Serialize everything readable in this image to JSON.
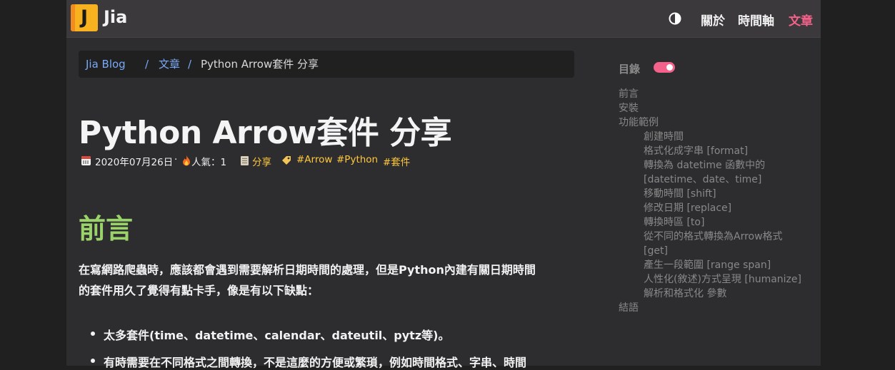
{
  "nav": {
    "logo_letter": "J",
    "site_name": "Jia",
    "theme_icon": "contrast-icon",
    "links": [
      "關於",
      "時間軸",
      "文章"
    ],
    "active_color": "#f4618a"
  },
  "breadcrumb": {
    "home": "Jia Blog",
    "sep": "/",
    "section": "文章",
    "current": "Python Arrow套件 分享"
  },
  "post": {
    "title": "Python Arrow套件 分享",
    "date": "2020年07月26日",
    "dot": "·",
    "popularity_label": "人氣：1",
    "category": "分享",
    "tags": [
      "#Arrow",
      "#Python",
      "#套件"
    ],
    "icons": [
      "calendar-icon",
      "fire-icon",
      "clipboard-icon",
      "tag-icon"
    ]
  },
  "content": {
    "heading": "前言",
    "heading_color": "#9bd36b",
    "paragraph_lines": [
      "在寫網路爬蟲時，應該都會遇到需要解析日期時間的處理，但是Python內建有關日期時間",
      "的套件用久了覺得有點卡手，像是有以下缺點："
    ],
    "bullets": [
      "太多套件(time、datetime、calendar、dateutil、pytz等)。",
      "有時需要在不同格式之間轉換，不是這麼的方便或繁瑣，例如時間格式、字串、時間"
    ]
  },
  "toc": {
    "label": "目錄",
    "toggle_on": true,
    "items": [
      {
        "text": "前言",
        "level": 1
      },
      {
        "text": "安裝",
        "level": 1
      },
      {
        "text": "功能範例",
        "level": 1
      },
      {
        "text": "創建時間",
        "level": 2
      },
      {
        "text": "格式化成字串 [format]",
        "level": 2
      },
      {
        "text": "轉換為 datetime 函數中的",
        "level": 2
      },
      {
        "text": "[datetime、date、time]",
        "level": 2
      },
      {
        "text": "移動時間 [shift]",
        "level": 2
      },
      {
        "text": "修改日期 [replace]",
        "level": 2
      },
      {
        "text": "轉換時區 [to]",
        "level": 2
      },
      {
        "text": "從不同的格式轉換為Arrow格式",
        "level": 2
      },
      {
        "text": "[get]",
        "level": 2
      },
      {
        "text": "產生一段範圍 [range span]",
        "level": 2
      },
      {
        "text": "人性化(敘述)方式呈現 [humanize]",
        "level": 2
      },
      {
        "text": "解析和格式化 參數",
        "level": 2
      },
      {
        "text": "結語",
        "level": 1
      }
    ]
  }
}
